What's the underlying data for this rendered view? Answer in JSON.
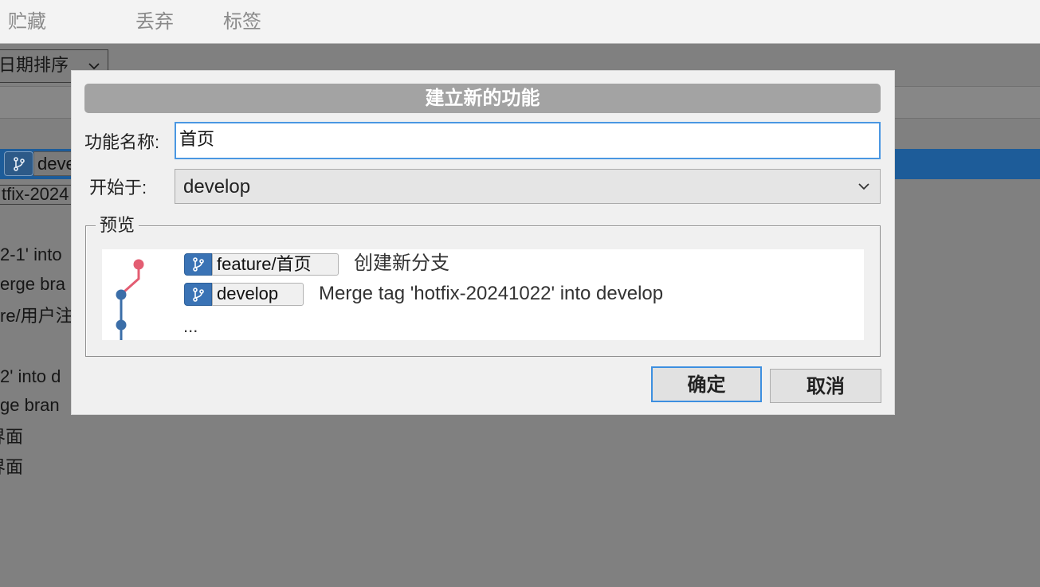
{
  "toolbar": {
    "items": [
      {
        "label": "贮藏",
        "icon": "stash-icon"
      },
      {
        "label": "丢弃",
        "icon": "discard-icon"
      },
      {
        "label": "标签",
        "icon": "tag-icon"
      }
    ]
  },
  "background": {
    "sort_select": "日期排序",
    "selected_branch": "deve",
    "tag": "tfix-2024",
    "rows": [
      "2-1' into",
      "erge bra",
      "re/用户注",
      "2' into d",
      "ge bran",
      "界面",
      "界面"
    ]
  },
  "dialog": {
    "title": "建立新的功能",
    "name_label": "功能名称:",
    "name_value": "首页",
    "start_label": "开始于:",
    "start_value": "develop",
    "preview_label": "预览",
    "preview": {
      "rows": [
        {
          "branch": "feature/首页",
          "message": "创建新分支"
        },
        {
          "branch": "develop",
          "message": "Merge tag 'hotfix-20241022' into develop"
        }
      ],
      "more": "..."
    },
    "ok_label": "确定",
    "cancel_label": "取消"
  },
  "icons": {
    "branch": "branch-icon",
    "dropdown": "chevron-down-icon"
  },
  "colors": {
    "overlay_gray": "#808080",
    "selection_blue": "#1d5c99",
    "dialog_bg": "#f0f0f0",
    "title_bar": "#a3a3a3",
    "focus_blue": "#3d8fe0",
    "branch_badge_blue": "#3a73b5",
    "graph_red": "#e35d72",
    "graph_blue": "#3b6ea8"
  }
}
